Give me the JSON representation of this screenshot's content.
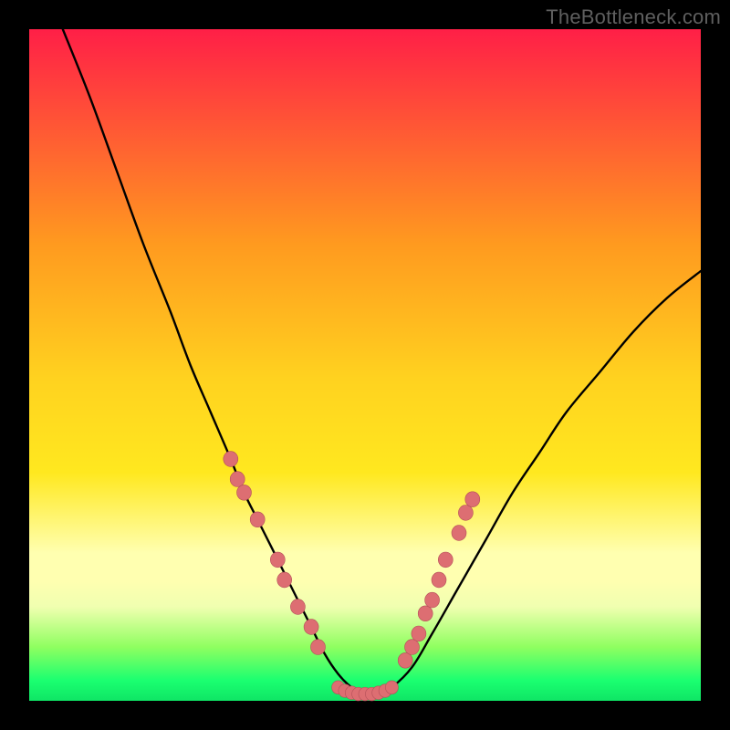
{
  "attribution": "TheBottleneck.com",
  "colors": {
    "red": "#ff1f47",
    "orange": "#ff9a1f",
    "yellow_top": "#ffd21f",
    "yellow_mid": "#ffe81f",
    "pale_yellow": "#ffffb0",
    "pale_band": "#f0ffb0",
    "green_light": "#8fff60",
    "green": "#1aff70",
    "green_dark": "#0fe565",
    "black": "#000000",
    "curve": "#000000",
    "marker_fill": "#dd6e72",
    "marker_edge": "#b45059"
  },
  "chart_data": {
    "type": "line",
    "title": "",
    "xlabel": "",
    "ylabel": "",
    "xlim": [
      0,
      100
    ],
    "ylim": [
      0,
      100
    ],
    "series": [
      {
        "name": "bottleneck_curve",
        "x": [
          5,
          9,
          13,
          17,
          21,
          24,
          27,
          30,
          32,
          34,
          36,
          38,
          40,
          42,
          44,
          46,
          48,
          50,
          52,
          54,
          57,
          60,
          64,
          68,
          72,
          76,
          80,
          85,
          90,
          95,
          100
        ],
        "y": [
          100,
          90,
          79,
          68,
          58,
          50,
          43,
          36,
          31,
          27,
          23,
          19,
          15,
          11,
          7,
          4,
          2,
          1,
          1,
          2,
          5,
          10,
          17,
          24,
          31,
          37,
          43,
          49,
          55,
          60,
          64
        ]
      }
    ],
    "highlight_markers_left": [
      {
        "x": 30,
        "y": 36
      },
      {
        "x": 31,
        "y": 33
      },
      {
        "x": 32,
        "y": 31
      },
      {
        "x": 34,
        "y": 27
      },
      {
        "x": 37,
        "y": 21
      },
      {
        "x": 38,
        "y": 18
      },
      {
        "x": 40,
        "y": 14
      },
      {
        "x": 42,
        "y": 11
      },
      {
        "x": 43,
        "y": 8
      }
    ],
    "highlight_markers_bottom": [
      {
        "x": 46,
        "y": 2
      },
      {
        "x": 47,
        "y": 1.5
      },
      {
        "x": 48,
        "y": 1.2
      },
      {
        "x": 49,
        "y": 1
      },
      {
        "x": 50,
        "y": 1
      },
      {
        "x": 51,
        "y": 1
      },
      {
        "x": 52,
        "y": 1.2
      },
      {
        "x": 53,
        "y": 1.5
      },
      {
        "x": 54,
        "y": 2
      }
    ],
    "highlight_markers_right": [
      {
        "x": 56,
        "y": 6
      },
      {
        "x": 57,
        "y": 8
      },
      {
        "x": 58,
        "y": 10
      },
      {
        "x": 59,
        "y": 13
      },
      {
        "x": 60,
        "y": 15
      },
      {
        "x": 61,
        "y": 18
      },
      {
        "x": 62,
        "y": 21
      },
      {
        "x": 64,
        "y": 25
      },
      {
        "x": 65,
        "y": 28
      },
      {
        "x": 66,
        "y": 30
      }
    ]
  }
}
